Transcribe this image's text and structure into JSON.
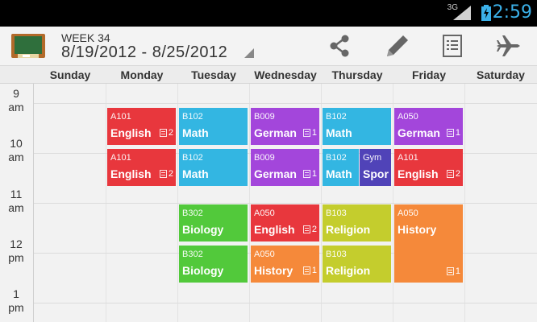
{
  "status": {
    "network": "3G",
    "time": "2:59"
  },
  "header": {
    "week": "WEEK 34",
    "date_range": "8/19/2012 - 8/25/2012"
  },
  "days": [
    "Sunday",
    "Monday",
    "Tuesday",
    "Wednesday",
    "Thursday",
    "Friday",
    "Saturday"
  ],
  "times": [
    {
      "hour": "9",
      "ampm": "am"
    },
    {
      "hour": "10",
      "ampm": "am"
    },
    {
      "hour": "11",
      "ampm": "am"
    },
    {
      "hour": "12",
      "ampm": "pm"
    },
    {
      "hour": "1",
      "ampm": "pm"
    }
  ],
  "lessons": {
    "mon1": {
      "room": "A101",
      "subject": "English",
      "note": "2"
    },
    "mon2": {
      "room": "A101",
      "subject": "English",
      "note": "2"
    },
    "tue1": {
      "room": "B102",
      "subject": "Math"
    },
    "tue2": {
      "room": "B102",
      "subject": "Math"
    },
    "tue3": {
      "room": "B302",
      "subject": "Biology"
    },
    "tue4": {
      "room": "B302",
      "subject": "Biology"
    },
    "wed1": {
      "room": "B009",
      "subject": "German",
      "note": "1"
    },
    "wed2": {
      "room": "B009",
      "subject": "German",
      "note": "1"
    },
    "wed3": {
      "room": "A050",
      "subject": "English",
      "note": "2"
    },
    "wed4": {
      "room": "A050",
      "subject": "History",
      "note": "1"
    },
    "thu1": {
      "room": "B102",
      "subject": "Math"
    },
    "thu2a": {
      "room": "B102",
      "subject": "Math"
    },
    "thu2b": {
      "room": "Gym",
      "subject": "Spor"
    },
    "thu3": {
      "room": "B103",
      "subject": "Religion"
    },
    "thu4": {
      "room": "B103",
      "subject": "Religion"
    },
    "fri1": {
      "room": "A050",
      "subject": "German",
      "note": "1"
    },
    "fri2": {
      "room": "A101",
      "subject": "English",
      "note": "2"
    },
    "fri3": {
      "room": "A050",
      "subject": "History",
      "note": "1"
    }
  },
  "colors": {
    "English": "#e8373d",
    "Math": "#33b6e2",
    "German": "#a346db",
    "Biology": "#52c93b",
    "History": "#f5893a",
    "Religion": "#c4cd2d",
    "Sport": "#5043b8"
  },
  "icons": [
    "share-icon",
    "edit-icon",
    "notes-icon",
    "airplane-icon"
  ]
}
